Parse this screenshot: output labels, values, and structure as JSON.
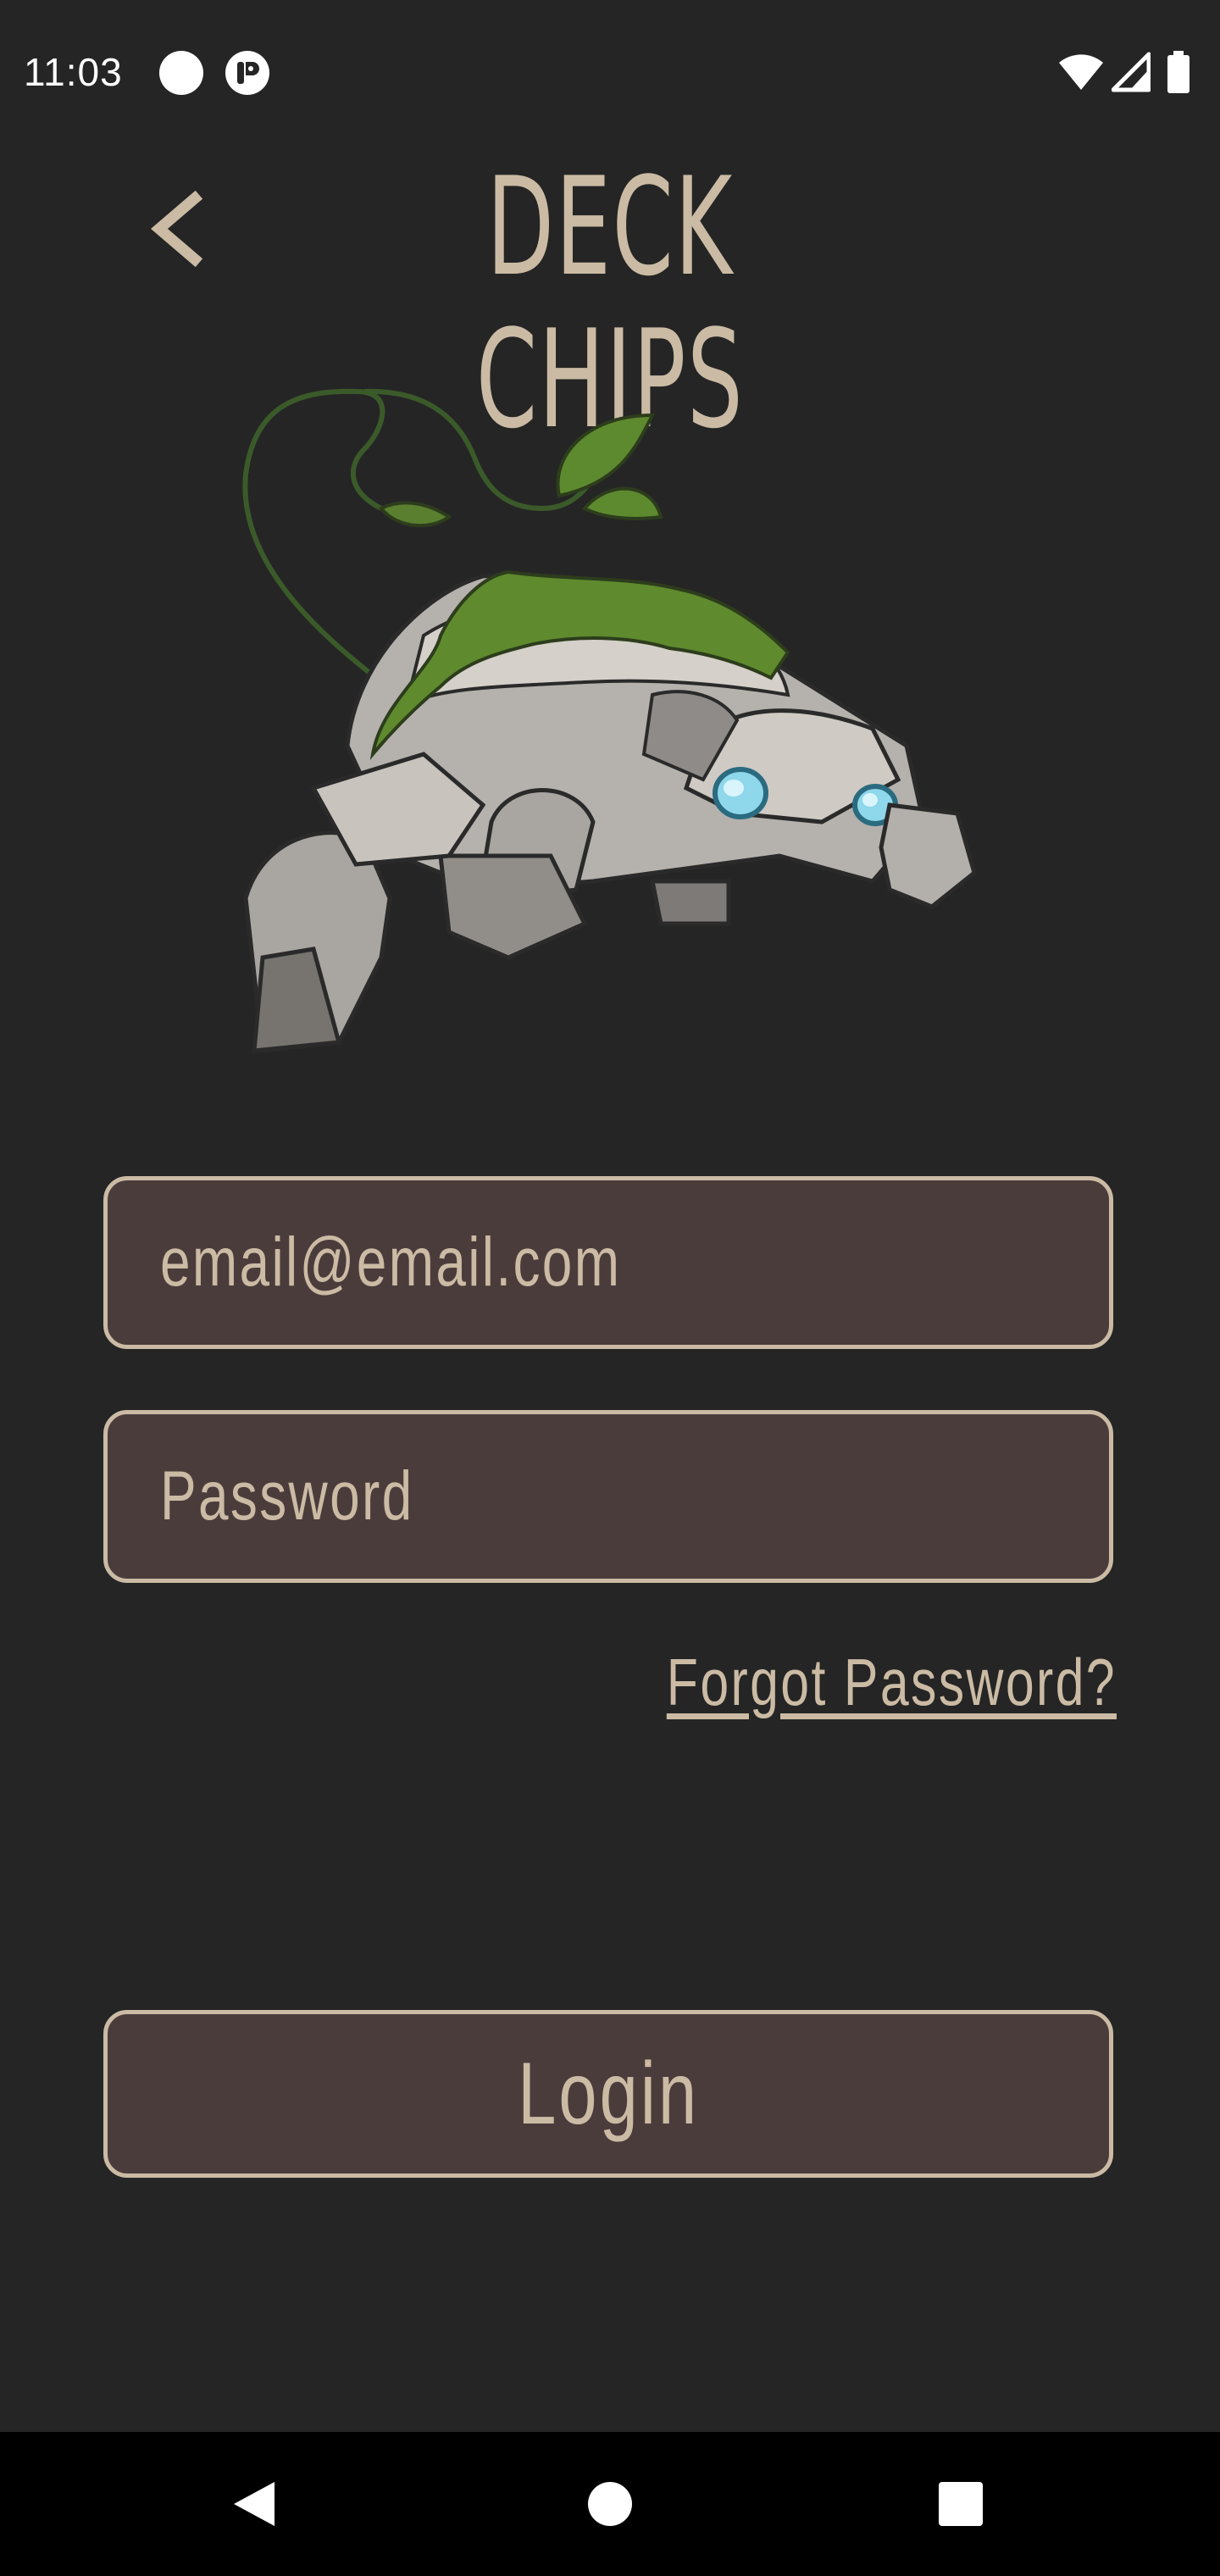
{
  "status_bar": {
    "time": "11:03"
  },
  "header": {
    "title": "DECK CHIPS",
    "back_icon": "chevron-left-icon"
  },
  "mascot": {
    "icon": "rock-golem-illustration"
  },
  "login_form": {
    "email_value": "email@email.com",
    "password_placeholder": "Password",
    "forgot_password_label": "Forgot Password?",
    "login_label": "Login"
  },
  "nav_bar": {
    "back": "nav-back-icon",
    "home": "nav-home-icon",
    "recents": "nav-recents-icon"
  },
  "colors": {
    "background": "#252525",
    "accent": "#cbbba4",
    "field_fill": "#4b3c3c",
    "nav_bar": "#000000"
  }
}
